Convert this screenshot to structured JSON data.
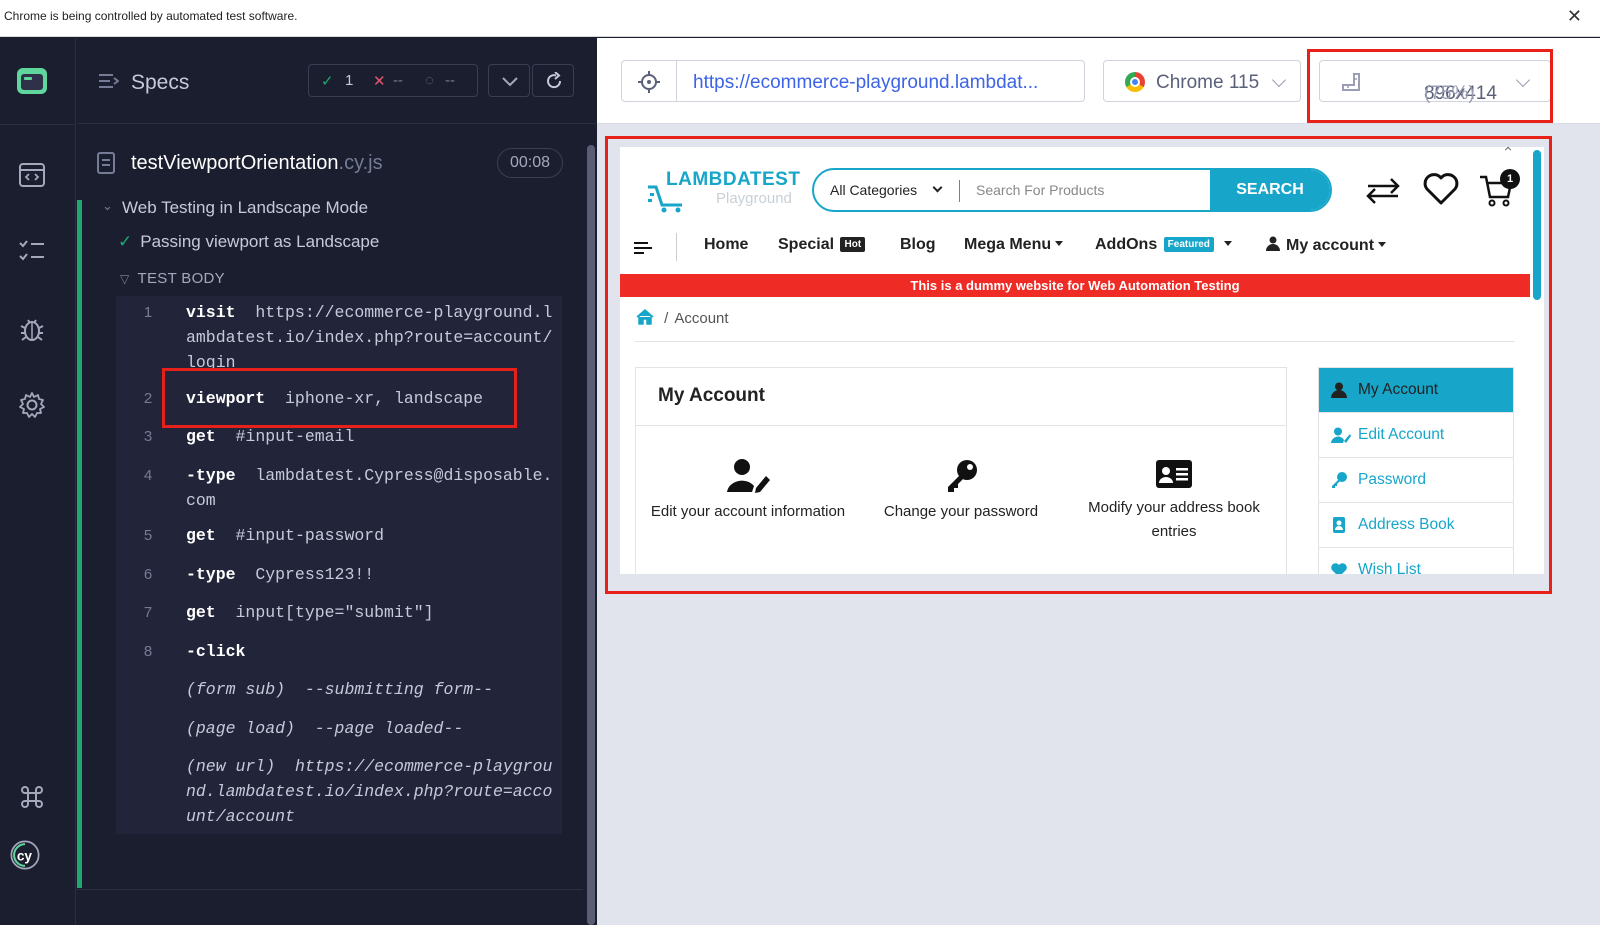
{
  "automation_bar": {
    "message": "Chrome is being controlled by automated test software.",
    "close": "✕"
  },
  "rail": {
    "icons": [
      "cypress-app-icon",
      "specs-icon",
      "runs-icon",
      "debug-icon",
      "settings-icon",
      "keyboard-shortcuts-icon",
      "cypress-logo-icon"
    ]
  },
  "specs": {
    "title": "Specs",
    "stats": {
      "passed": "1",
      "failed": "--",
      "pending": "--"
    },
    "file": {
      "name": "testViewportOrientation",
      "ext": ".cy.js",
      "duration": "00:08"
    },
    "suite": "Web Testing in Landscape Mode",
    "test": "Passing viewport as Landscape",
    "body_label": "TEST BODY",
    "commands": [
      {
        "num": "1",
        "kw": "visit",
        "arg": "https://ecommerce-playground.lambdatest.io/index.php?route=account/login"
      },
      {
        "num": "2",
        "kw": "viewport",
        "arg": "iphone-xr, landscape"
      },
      {
        "num": "3",
        "kw": "get",
        "arg": "#input-email"
      },
      {
        "num": "4",
        "kw": "-type",
        "arg": "lambdatest.Cypress@disposable.com"
      },
      {
        "num": "5",
        "kw": "get",
        "arg": "#input-password"
      },
      {
        "num": "6",
        "kw": "-type",
        "arg": "Cypress123!!"
      },
      {
        "num": "7",
        "kw": "get",
        "arg": "input[type=\"submit\"]"
      },
      {
        "num": "8",
        "kw": "-click",
        "arg": ""
      }
    ],
    "events": [
      {
        "kw": "(form sub)",
        "arg": "--submitting form--"
      },
      {
        "kw": "(page load)",
        "arg": "--page loaded--"
      },
      {
        "kw": "(new url)",
        "arg": "https://ecommerce-playground.lambdatest.io/index.php?route=account/account"
      }
    ]
  },
  "runner": {
    "url": "https://ecommerce-playground.lambdat...",
    "browser": "Chrome 115",
    "viewport": "896x414",
    "scale": "(75%)"
  },
  "site": {
    "logo_top": "LAMBDATEST",
    "logo_bottom": "Playground",
    "search": {
      "category": "All Categories",
      "placeholder": "Search For Products",
      "button": "SEARCH"
    },
    "cart_count": "1",
    "nav": {
      "home": "Home",
      "special": "Special",
      "hot": "Hot",
      "blog": "Blog",
      "mega": "Mega Menu",
      "addons": "AddOns",
      "featured": "Featured",
      "account": "My account"
    },
    "banner": "This is a dummy website for Web Automation Testing",
    "breadcrumb": {
      "sep": "/",
      "current": "Account"
    },
    "card_title": "My Account",
    "tiles": [
      "Edit your account information",
      "Change your password",
      "Modify your address book entries"
    ],
    "side_menu": [
      "My Account",
      "Edit Account",
      "Password",
      "Address Book",
      "Wish List"
    ]
  }
}
